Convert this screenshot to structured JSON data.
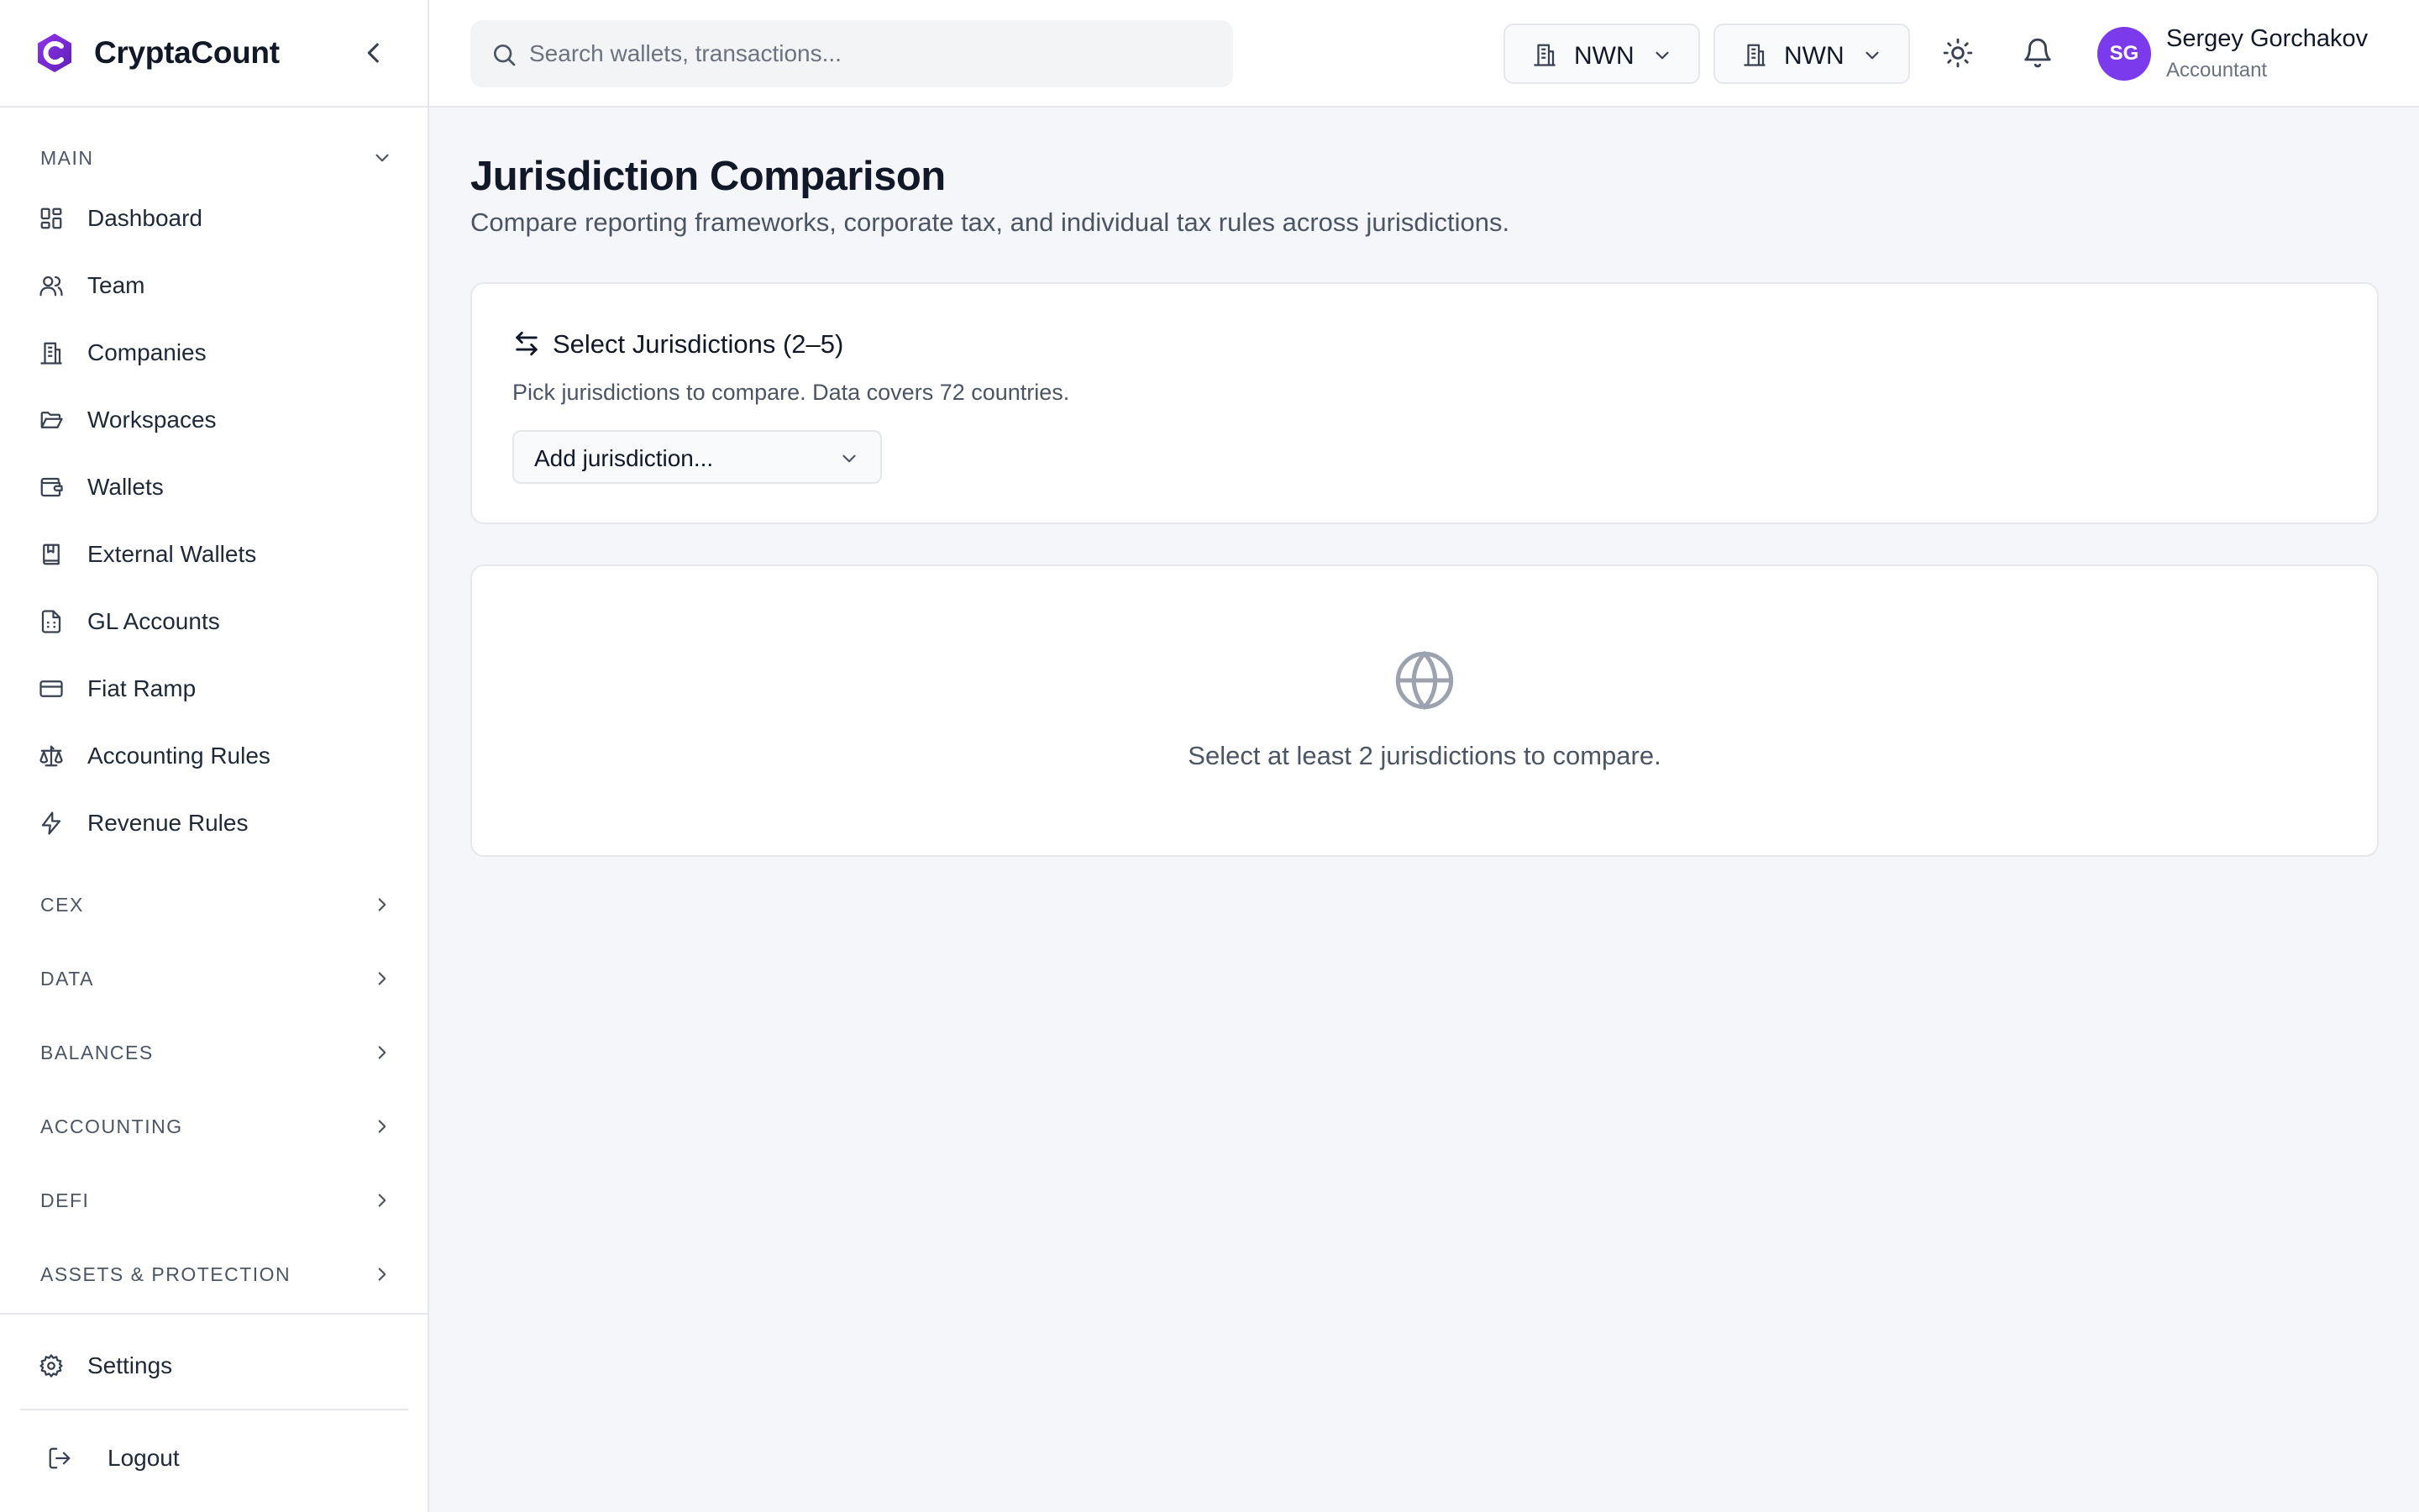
{
  "brand": {
    "name": "CryptaCount",
    "accent": "#7c3aed"
  },
  "sidebar": {
    "sections": {
      "main": "MAIN",
      "cex": "CEX",
      "data": "DATA",
      "balances": "BALANCES",
      "accounting": "ACCOUNTING",
      "defi": "DEFI",
      "assets": "ASSETS & PROTECTION"
    },
    "items": [
      {
        "label": "Dashboard",
        "icon": "dashboard-icon"
      },
      {
        "label": "Team",
        "icon": "users-icon"
      },
      {
        "label": "Companies",
        "icon": "building-icon"
      },
      {
        "label": "Workspaces",
        "icon": "folder-icon"
      },
      {
        "label": "Wallets",
        "icon": "wallet-icon"
      },
      {
        "label": "External Wallets",
        "icon": "bookmark-book-icon"
      },
      {
        "label": "GL Accounts",
        "icon": "spreadsheet-icon"
      },
      {
        "label": "Fiat Ramp",
        "icon": "credit-card-icon"
      },
      {
        "label": "Accounting Rules",
        "icon": "scale-icon"
      },
      {
        "label": "Revenue Rules",
        "icon": "lightning-icon"
      }
    ],
    "settings_label": "Settings",
    "logout_label": "Logout"
  },
  "topbar": {
    "search_placeholder": "Search wallets, transactions...",
    "selector_1": "NWN",
    "selector_2": "NWN",
    "user": {
      "initials": "SG",
      "name": "Sergey Gorchakov",
      "role": "Accountant"
    }
  },
  "main": {
    "title": "Jurisdiction Comparison",
    "subtitle": "Compare reporting frameworks, corporate tax, and individual tax rules across jurisdictions.",
    "select_card": {
      "title": "Select Jurisdictions (2–5)",
      "description": "Pick jurisdictions to compare. Data covers 72 countries.",
      "dropdown_value": "Add jurisdiction..."
    },
    "empty_state": {
      "message": "Select at least 2 jurisdictions to compare."
    }
  }
}
